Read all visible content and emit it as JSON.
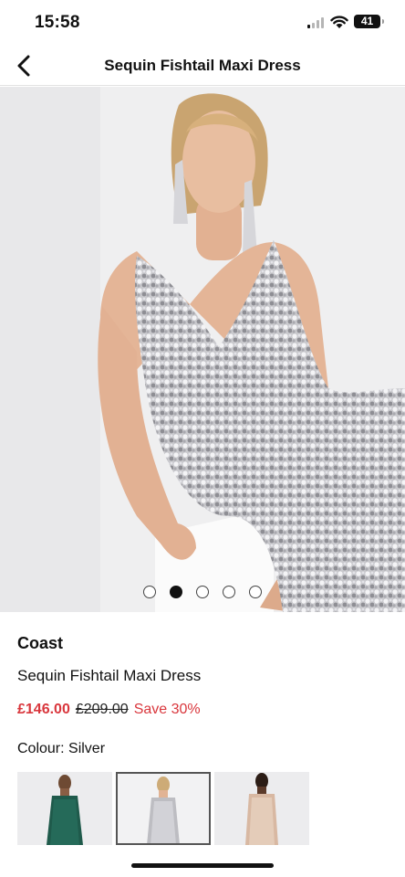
{
  "status_bar": {
    "time": "15:58",
    "battery": "41"
  },
  "nav": {
    "title": "Sequin Fishtail Maxi Dress"
  },
  "gallery": {
    "dot_count": 5,
    "active_index": 1
  },
  "product": {
    "brand": "Coast",
    "name": "Sequin Fishtail Maxi Dress",
    "price": "£146.00",
    "was_price": "£209.00",
    "save": "Save 30%",
    "colour_label": "Colour: Silver"
  },
  "swatches": [
    {
      "colour": "emerald",
      "selected": false
    },
    {
      "colour": "silver",
      "selected": true
    },
    {
      "colour": "rose gold",
      "selected": false
    }
  ],
  "colors": {
    "sale_red": "#d9373d",
    "divider": "#e2e2e2"
  },
  "icons": [
    "chevron-left-icon",
    "signal-icon",
    "wifi-icon",
    "battery-icon"
  ]
}
